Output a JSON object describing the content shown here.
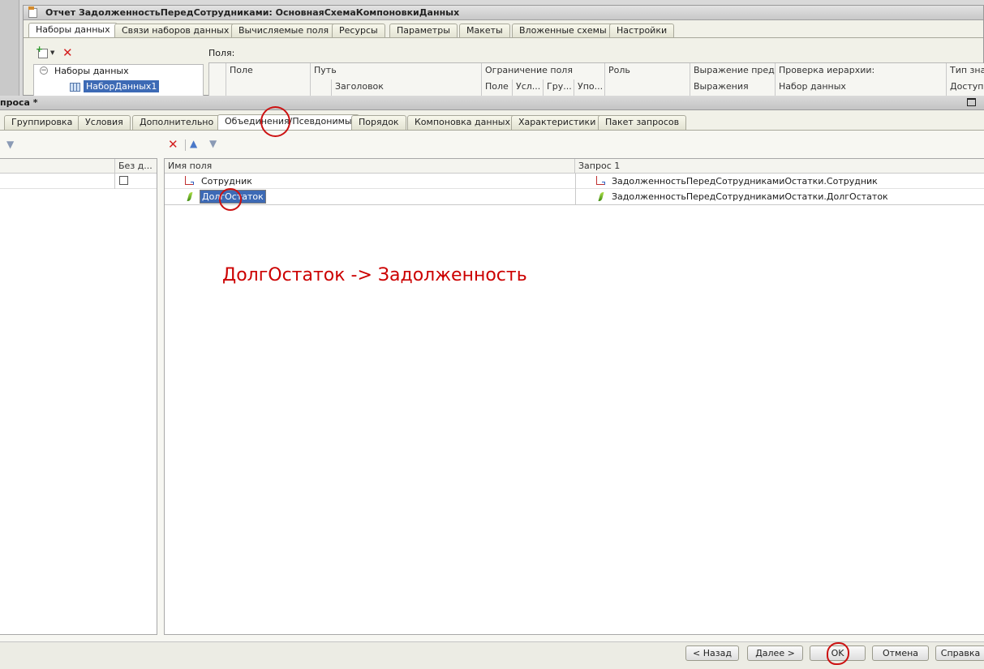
{
  "bg_window": {
    "title": "Отчет ЗадолженностьПередСотрудниками: ОсновнаяСхемаКомпоновкиДанных",
    "tabs": [
      "Наборы данных",
      "Связи наборов данных",
      "Вычисляемые поля",
      "Ресурсы",
      "Параметры",
      "Макеты",
      "Вложенные схемы",
      "Настройки"
    ],
    "tree": {
      "root": "Наборы данных",
      "child": "НаборДанных1"
    },
    "fields_label": "Поля:",
    "columns": {
      "field": "Поле",
      "path": "Путь",
      "title": "Заголовок",
      "limit": "Ограничение поля",
      "limit_sub": [
        "Поле",
        "Усл...",
        "Гру...",
        "Упо..."
      ],
      "role": "Роль",
      "expr": "Выражение пред...",
      "expr_sub": "Выражения",
      "hier": "Проверка иерархии:",
      "hier_sub": "Набор данных",
      "type": "Тип знач",
      "type_sub": "Доступн"
    }
  },
  "qb_window": {
    "title": "проса *",
    "tabs": [
      "Группировка",
      "Условия",
      "Дополнительно",
      "Объединения/Псевдонимы",
      "Порядок",
      "Компоновка данных",
      "Характеристики",
      "Пакет запросов"
    ],
    "left_header": "Без д...",
    "grid": {
      "col_field": "Имя поля",
      "col_query": "Запрос 1",
      "rows": [
        {
          "name": "Сотрудник",
          "source": "ЗадолженностьПередСотрудникамиОстатки.Сотрудник",
          "icon": "dimension-icon"
        },
        {
          "name": "ДолгОстаток",
          "source": "ЗадолженностьПередСотрудникамиОстатки.ДолгОстаток",
          "icon": "resource-icon"
        }
      ]
    },
    "annotation": "ДолгОстаток -> Задолженность",
    "buttons": {
      "back": "< Назад",
      "next": "Далее >",
      "ok": "OK",
      "cancel": "Отмена",
      "help": "Справка"
    }
  },
  "colors": {
    "annotation": "#cc0000",
    "selection": "#3d6ab5"
  }
}
